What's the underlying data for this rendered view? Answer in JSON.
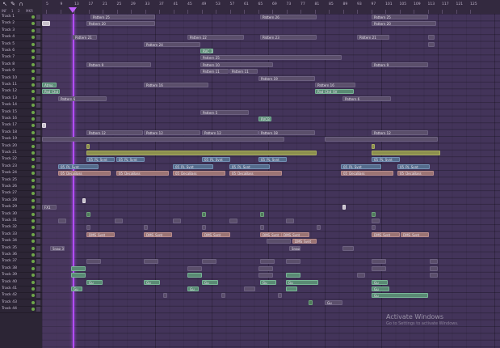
{
  "toolbar": {
    "icons": [
      "arrow-icon",
      "pencil-icon",
      "magnet-icon"
    ],
    "labels": [
      "INF",
      "1",
      "2",
      "MKR"
    ]
  },
  "ruler": {
    "numbers": [
      "5",
      "9",
      "13",
      "17",
      "21",
      "25",
      "29",
      "33",
      "37",
      "41",
      "45",
      "49",
      "53",
      "57",
      "61",
      "65",
      "69",
      "73",
      "77",
      "81",
      "85",
      "89",
      "93",
      "97",
      "101",
      "105",
      "109",
      "113",
      "117",
      "121",
      "125"
    ]
  },
  "tracks": [
    "Track 1",
    "Track 2",
    "Track 3",
    "Track 4",
    "Track 5",
    "Track 6",
    "Track 7",
    "Track 8",
    "Track 9",
    "Track 10",
    "Track 11",
    "Track 12",
    "Track 13",
    "Track 14",
    "Track 15",
    "Track 16",
    "Track 17",
    "Track 18",
    "Track 19",
    "Track 20",
    "Track 21",
    "Track 22",
    "Track 23",
    "Track 24",
    "Track 25",
    "Track 26",
    "Track 27",
    "Track 28",
    "Track 29",
    "Track 30",
    "Track 31",
    "Track 32",
    "Track 33",
    "Track 34",
    "Track 35",
    "Track 36",
    "Track 37",
    "Track 38",
    "Track 39",
    "Track 40",
    "Track 41",
    "Track 42",
    "Track 43",
    "Track 44"
  ],
  "clips": {
    "pattern25": "Pattern 25",
    "pattern26": "Pattern 26",
    "pattern20": "Pattern 20",
    "pattern21": "Pattern 21",
    "pattern22": "Pattern 22",
    "pattern23": "Pattern 23",
    "pattern24": "Pattern 24",
    "pattern9": "Pattern 9",
    "pattern10": "Pattern 10",
    "pattern11": "Pattern 11",
    "pattern12": "Pattern 12",
    "pattern13": "Pattern 13",
    "pattern14": "Pattern 14",
    "pattern16": "Pattern 16",
    "pattern18": "Pattern 18",
    "pattern19": "Pattern 19",
    "pattern5": "Pattern 5",
    "pattern6": "Pattern 6",
    "vocal": "Vocal_Bass",
    "rvcb": "RVCB",
    "synth": "05_PL_Synt",
    "dbass": "05_DecaBass",
    "chord": "DMS_Synt",
    "gu": "Gu",
    "fx": "FX1",
    "atmo": "Atmo",
    "snap": "Snap 3",
    "rvc": "RVC_1",
    "pad": "Pad_Chd_SV"
  },
  "watermark": {
    "title": "Activate Windows",
    "subtitle": "Go to Settings to activate Windows."
  },
  "colors": {
    "background": "#3b2e49",
    "playhead": "#b24cff",
    "audio_clip": "#5a8a74",
    "pattern_clip": "#5b4f6b"
  }
}
